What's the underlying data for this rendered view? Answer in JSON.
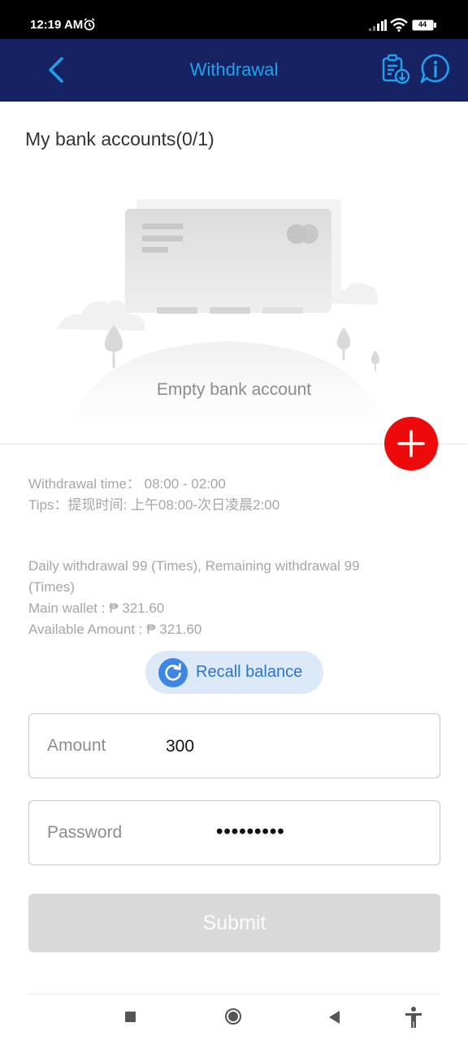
{
  "status_bar": {
    "time": "12:19 AM",
    "battery": "44",
    "icons": [
      "alarm-icon",
      "signal-icon",
      "wifi-icon",
      "battery-icon"
    ]
  },
  "header": {
    "title": "Withdrawal",
    "back_icon": "chevron-left-icon",
    "records_icon": "clipboard-download-icon",
    "info_icon": "info-bubble-icon"
  },
  "bank_accounts": {
    "title": "My bank accounts(0/1)",
    "empty_text": "Empty bank account"
  },
  "info": {
    "withdrawal_time": "Withdrawal time：  08:00 - 02:00",
    "tips": "Tips：提现时间: 上午08:00-次日凌晨2:00",
    "daily_line1": "Daily withdrawal 99 (Times), Remaining withdrawal 99",
    "daily_line2": "(Times)",
    "main_wallet": "Main wallet : ₱ 321.60",
    "available_amount": "Available Amount : ₱ 321.60"
  },
  "recall": {
    "label": "Recall balance"
  },
  "form": {
    "amount_label": "Amount",
    "amount_value": "300",
    "password_label": "Password",
    "password_value": "•••••••••",
    "submit_label": "Submit"
  },
  "colors": {
    "header_bg": "#172262",
    "accent": "#1ea2f0",
    "add_button": "#ee0a0a",
    "recall_bg": "#dbe9f9",
    "recall_text": "#2d73cd"
  }
}
